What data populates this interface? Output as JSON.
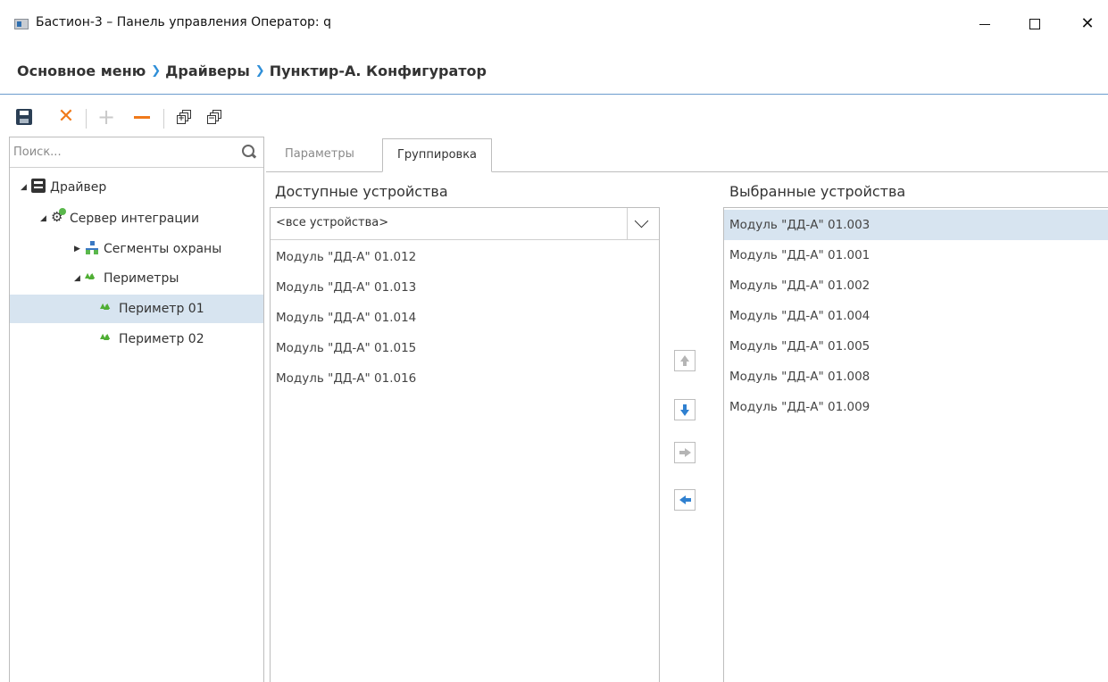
{
  "window": {
    "title": "Бастион-3 – Панель управления Оператор: q",
    "close_symbol": "✕"
  },
  "breadcrumb": {
    "items": [
      "Основное меню",
      "Драйверы",
      "Пунктир-А. Конфигуратор"
    ],
    "separator": "❯"
  },
  "toolbar": {
    "cancel_symbol": "✕",
    "add_symbol": "+",
    "expand_symbol": "+",
    "collapse_symbol": "−",
    "icons": [
      "save-icon",
      "cancel-icon",
      "add-icon",
      "remove-icon",
      "expand-all-icon",
      "collapse-all-icon"
    ]
  },
  "search": {
    "placeholder": "Поиск..."
  },
  "tree": {
    "expanded_glyph": "◢",
    "collapsed_glyph": "▶",
    "items": [
      {
        "label": "Драйвер",
        "icon": "driver-icon",
        "expanded": true
      },
      {
        "label": "Сервер интеграции",
        "icon": "server-icon",
        "expanded": true
      },
      {
        "label": "Сегменты охраны",
        "icon": "segment-icon",
        "expanded": false
      },
      {
        "label": "Периметры",
        "icon": "perimeter-icon",
        "expanded": true
      },
      {
        "label": "Периметр 01",
        "icon": "perimeter-icon",
        "selected": true
      },
      {
        "label": "Периметр 02",
        "icon": "perimeter-icon"
      }
    ]
  },
  "tabs": [
    {
      "label": "Параметры",
      "active": false
    },
    {
      "label": "Группировка",
      "active": true
    }
  ],
  "available": {
    "title": "Доступные устройства",
    "filter_value": "<все устройства>",
    "items": [
      "Модуль \"ДД-А\" 01.012",
      "Модуль \"ДД-А\" 01.013",
      "Модуль \"ДД-А\" 01.014",
      "Модуль \"ДД-А\" 01.015",
      "Модуль \"ДД-А\" 01.016"
    ]
  },
  "selected": {
    "title": "Выбранные устройства",
    "items": [
      "Модуль \"ДД-А\" 01.003",
      "Модуль \"ДД-А\" 01.001",
      "Модуль \"ДД-А\" 01.002",
      "Модуль \"ДД-А\" 01.004",
      "Модуль \"ДД-А\" 01.005",
      "Модуль \"ДД-А\" 01.008",
      "Модуль \"ДД-А\" 01.009"
    ],
    "highlighted": "Модуль \"ДД-А\" 01.003"
  },
  "move_buttons": {
    "up_enabled": false,
    "down_enabled": true,
    "add_enabled": false,
    "remove_enabled": true
  },
  "colors": {
    "accent": "#2f80d0",
    "orange": "#f07a1a",
    "selection": "#d7e4f0",
    "tree_green": "#4fae34"
  }
}
